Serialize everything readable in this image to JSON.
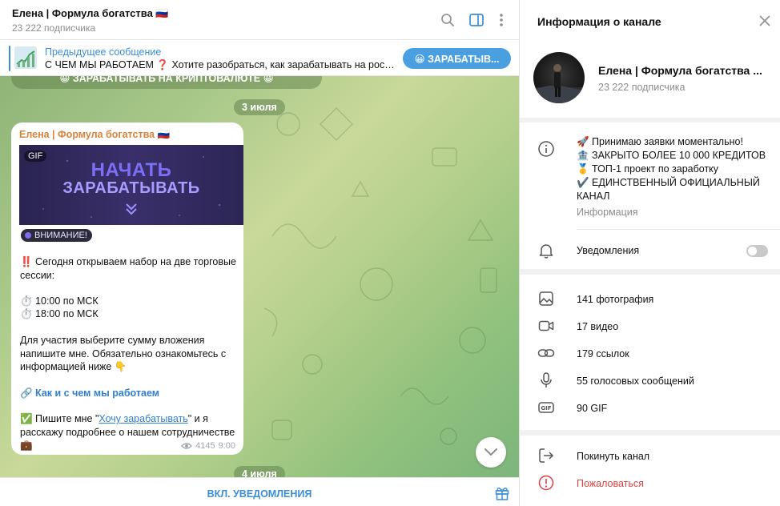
{
  "chat": {
    "title": "Елена | Формула богатства 🇷🇺",
    "subscribers": "23 222 подписчика",
    "pinned": {
      "title": "Предыдущее сообщение",
      "text": "С ЧЕМ МЫ РАБОТАЕМ ❓  Хотите разобраться, как зарабатывать на росте к...",
      "button_label": "😀 ЗАРАБАТЫВ..."
    },
    "previous_message_fragment": "😀 ЗАРАБАТЫВАТЬ НА КРИПТОВАЛЮТЕ 😀",
    "date_1": "3 июля",
    "date_2": "4 июля",
    "message": {
      "author": "Елена | Формула богатства 🇷🇺",
      "gif_badge": "GIF",
      "gif_line_1": "НАЧАТЬ",
      "gif_line_2": "ЗАРАБАТЫВАТЬ",
      "tag": "ВНИМАНИЕ!",
      "para_1": "‼️ Сегодня открываем набор на две торговые сессии:",
      "time_1": "⏱️ 10:00 по МСК",
      "time_2": "⏱️ 18:00 по МСК",
      "para_2": "Для участия выберите сумму вложения напишите мне. Обязательно ознакомьтесь с информацией ниже 👇",
      "link_label": "🔗 Как и с чем мы работаем",
      "para_3_before": "✅ Пишите мне \"",
      "para_3_link": "Хочу зарабатывать",
      "para_3_after": "\" и я расскажу подробнее о нашем сотрудничестве",
      "para_3_end": "💼",
      "views": "4145",
      "time": "9:00"
    },
    "footer_button": "ВКЛ. УВЕДОМЛЕНИЯ"
  },
  "info": {
    "header_title": "Информация о канале",
    "channel_name": "Елена | Формула богатства ...",
    "subscribers": "23 222 подписчика",
    "description_lines": [
      "🚀 Принимаю заявки моментально!",
      "🏦 ЗАКРЫТО БОЛЕЕ 10 000 КРЕДИТОВ",
      "🥇 ТОП-1 проект по заработку",
      "✔️ ЕДИНСТВЕННЫЙ ОФИЦИАЛЬНЫЙ КАНАЛ"
    ],
    "description_label": "Информация",
    "notifications_label": "Уведомления",
    "notifications_on": false,
    "media": [
      {
        "icon": "photo-icon",
        "label": "141 фотография"
      },
      {
        "icon": "video-icon",
        "label": "17 видео"
      },
      {
        "icon": "link-icon",
        "label": "179 ссылок"
      },
      {
        "icon": "microphone-icon",
        "label": "55 голосовых сообщений"
      },
      {
        "icon": "gif-icon",
        "label": "90 GIF"
      }
    ],
    "leave_label": "Покинуть канал",
    "report_label": "Пожаловаться"
  },
  "colors": {
    "accent": "#3a8ed6",
    "author": "#d9823a",
    "danger": "#e04040"
  }
}
